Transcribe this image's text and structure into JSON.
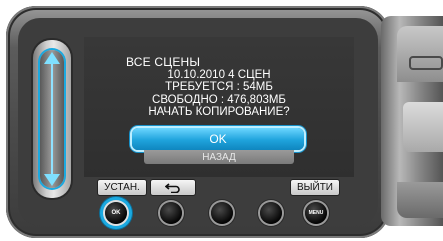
{
  "dialog": {
    "title": "ВСЕ СЦЕНЫ",
    "info_lines": [
      "10.10.2010 4 СЦЕН",
      "ТРЕБУЕТСЯ : 54МБ",
      "СВОБОДНО : 476,803МБ",
      "НАЧАТЬ КОПИРОВАНИЕ?"
    ],
    "ok_label": "OK",
    "back_label": "НАЗАД"
  },
  "softkeys": {
    "set_label": "УСТАН.",
    "return_icon": "return-arrow-icon",
    "exit_label": "ВЫЙТИ"
  },
  "buttons": {
    "ok_button_label": "OK",
    "menu_button_label": "MENU"
  },
  "colors": {
    "accent": "#1ba9e0",
    "screen_bg": "#333333"
  }
}
